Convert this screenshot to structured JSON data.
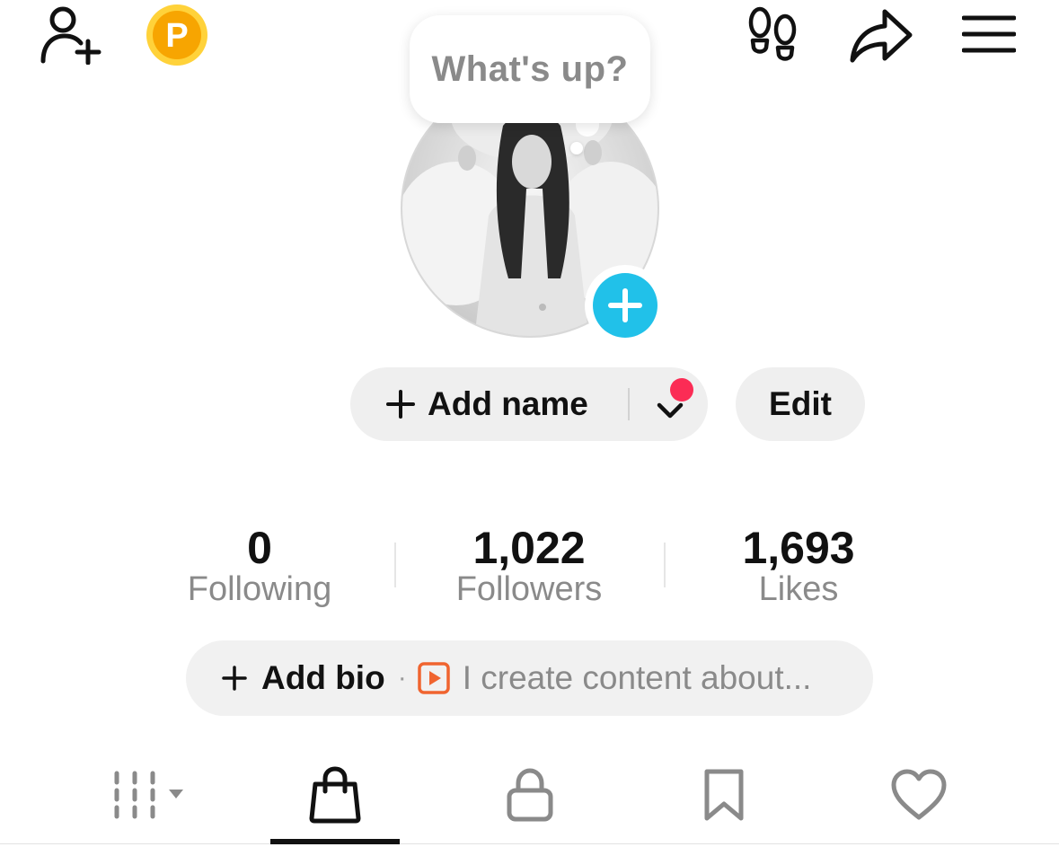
{
  "header": {
    "icons": [
      "add-friend-icon",
      "coin-icon",
      "footprint-icon",
      "share-icon",
      "menu-icon"
    ],
    "coin_letter": "P",
    "coin_color": "#f7a501"
  },
  "status_bubble": {
    "text": "What's up?"
  },
  "profile": {
    "add_name_label": "Add name",
    "edit_label": "Edit",
    "accent_color": "#21c1e9",
    "notification_color": "#fb2c55"
  },
  "stats": [
    {
      "value": "0",
      "label": "Following"
    },
    {
      "value": "1,022",
      "label": "Followers"
    },
    {
      "value": "1,693",
      "label": "Likes"
    }
  ],
  "bio": {
    "add_label": "Add bio",
    "separator": "·",
    "placeholder": "I create content about..."
  },
  "tabs": [
    {
      "name": "grid",
      "icon": "grid-icon",
      "active": false
    },
    {
      "name": "shop",
      "icon": "shopping-bag-icon",
      "active": true
    },
    {
      "name": "private",
      "icon": "lock-icon",
      "active": false
    },
    {
      "name": "saved",
      "icon": "bookmark-icon",
      "active": false
    },
    {
      "name": "liked",
      "icon": "heart-icon",
      "active": false
    }
  ]
}
